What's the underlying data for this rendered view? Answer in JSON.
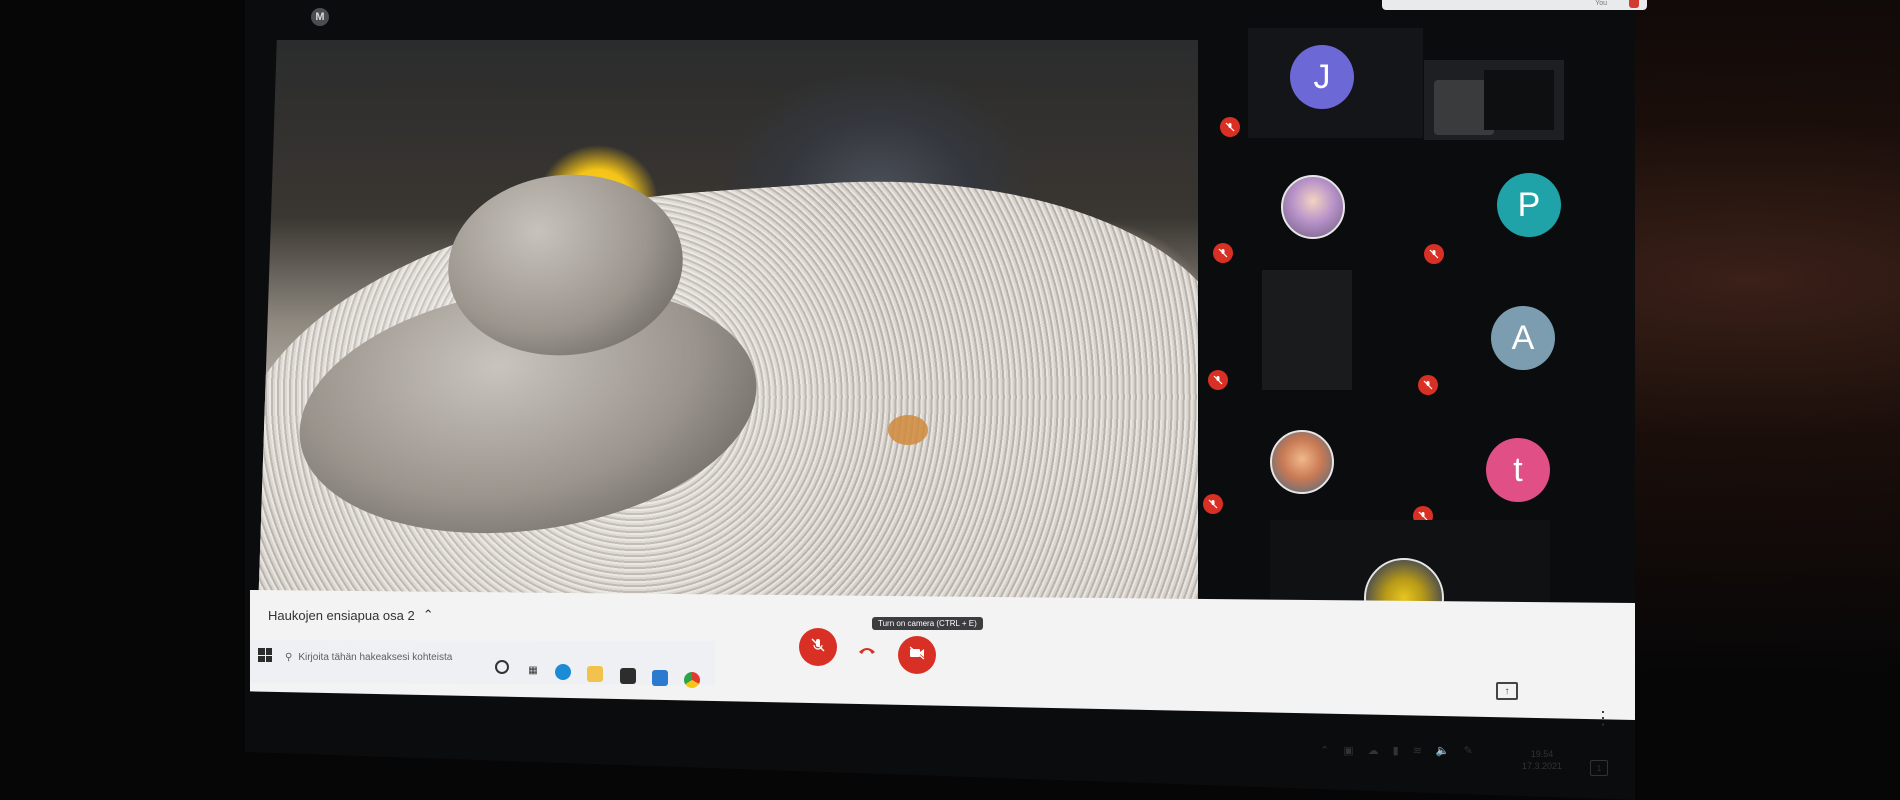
{
  "meeting": {
    "title": "Haukojen ensiapua osa 2",
    "tooltip": "Turn on camera (CTRL + E)"
  },
  "window": {
    "top_chip_text": "You"
  },
  "account": {
    "initial": "M"
  },
  "participants": {
    "avatars": [
      {
        "initial": "J",
        "color": "#6c69d6"
      },
      {
        "initial": "P",
        "color": "#1fa3a8"
      },
      {
        "initial": "A",
        "color": "#7c9db0"
      },
      {
        "initial": "t",
        "color": "#e04f86"
      }
    ]
  },
  "taskbar": {
    "search_placeholder": "Kirjoita tähän hakeaksesi kohteista"
  },
  "clock": {
    "time": "19.54",
    "date": "17.3.2021"
  },
  "notifications": {
    "count": "1"
  },
  "icons": [
    "mic-off-icon",
    "hang-up-icon",
    "camera-off-icon",
    "present-icon",
    "more-icon",
    "windows-icon",
    "search-icon",
    "edge-icon",
    "folder-icon",
    "store-icon",
    "mail-icon",
    "chrome-icon"
  ]
}
